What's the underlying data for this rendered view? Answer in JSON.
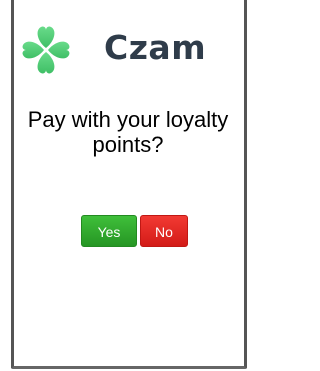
{
  "brand": {
    "name": "Czam",
    "logo_icon": "clover-icon",
    "logo_color": "#4fcf74",
    "text_color": "#2f3c4a"
  },
  "prompt": {
    "question": "Pay with your loyalty points?"
  },
  "actions": {
    "yes_label": "Yes",
    "no_label": "No",
    "yes_color": "#2fab2c",
    "no_color": "#e32a24"
  }
}
